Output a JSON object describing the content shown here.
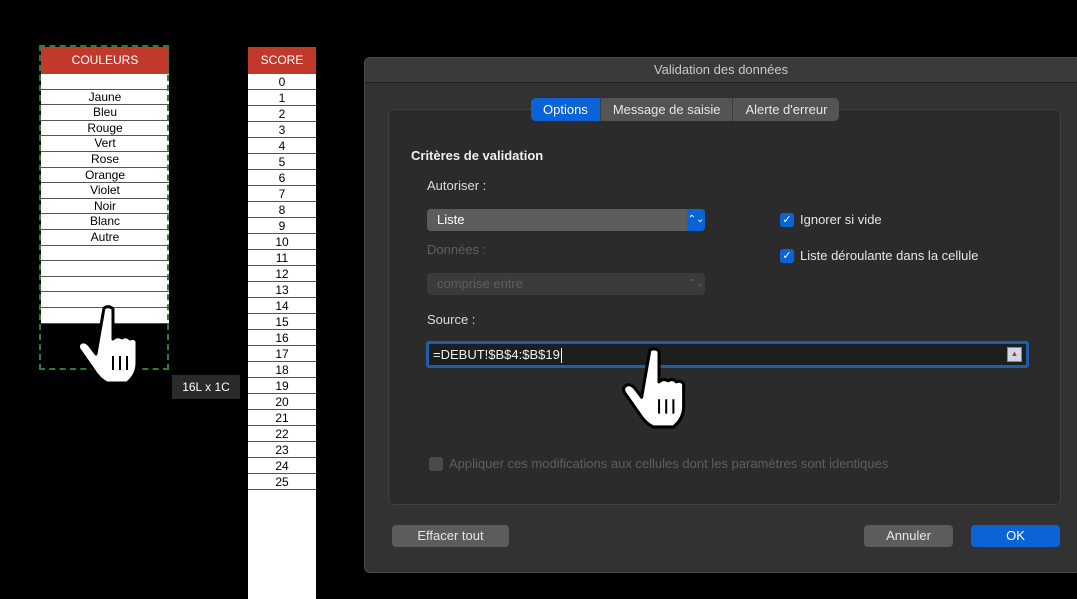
{
  "sheet": {
    "couleurs_header": "COULEURS",
    "couleurs": [
      "",
      "Jaune",
      "Bleu",
      "Rouge",
      "Vert",
      "Rose",
      "Orange",
      "Violet",
      "Noir",
      "Blanc",
      "Autre",
      "",
      "",
      "",
      "",
      ""
    ],
    "score_header": "SCORE",
    "score": [
      "0",
      "1",
      "2",
      "3",
      "4",
      "5",
      "6",
      "7",
      "8",
      "9",
      "10",
      "11",
      "12",
      "13",
      "14",
      "15",
      "16",
      "17",
      "18",
      "19",
      "20",
      "21",
      "22",
      "23",
      "24",
      "25"
    ],
    "selection_size": "16L x 1C",
    "header_color": "#c0392b",
    "selection_color": "#2e7d32"
  },
  "dialog": {
    "title": "Validation des données",
    "tabs": [
      "Options",
      "Message de saisie",
      "Alerte d'erreur"
    ],
    "active_tab": "Options",
    "section_title": "Critères de validation",
    "allow_label": "Autoriser :",
    "allow_value": "Liste",
    "data_label": "Données :",
    "data_value": "comprise entre",
    "ignore_blank": "Ignorer si vide",
    "ignore_blank_checked": true,
    "dropdown_in_cell": "Liste déroulante dans la cellule",
    "dropdown_in_cell_checked": true,
    "source_label": "Source :",
    "source_value": "=DEBUT!$B$4:$B$19",
    "apply_all": "Appliquer ces modifications aux cellules dont les paramètres sont identiques",
    "apply_all_checked": false,
    "clear_all": "Effacer tout",
    "cancel": "Annuler",
    "ok": "OK",
    "accent_color": "#0a64d8"
  },
  "icons": {
    "arrows": "⌃⌄",
    "check": "✓",
    "ref": "▲"
  }
}
